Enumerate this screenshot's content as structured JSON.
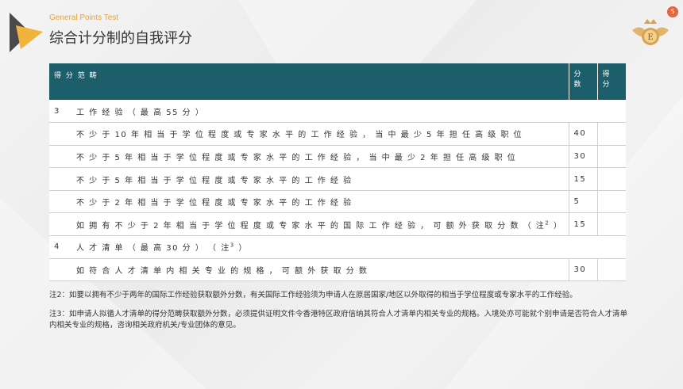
{
  "header": {
    "subtitle": "General Points Test",
    "title": "综合计分制的自我评分",
    "corner_icon": "s-badge-icon",
    "corner_text": "S"
  },
  "colors": {
    "header_bg": "#1d5e6b",
    "accent": "#e8a33a",
    "text": "#333333"
  },
  "table": {
    "headers": {
      "range": "得 分 范 畴",
      "score": "分 数",
      "got": "得 分"
    },
    "rows": [
      {
        "idx": "3",
        "text": "工 作 经 验 （ 最 高 55 分 ）",
        "score": "",
        "section": true
      },
      {
        "idx": "",
        "text": "不 少 于 10 年 相 当 于 学 位 程 度 或 专 家 水 平 的 工 作 经 验 ， 当 中 最 少 5 年 担 任 高 级 职 位",
        "score": "40"
      },
      {
        "idx": "",
        "text": "不 少 于 5 年 相 当 于 学 位 程 度 或 专 家 水 平 的 工 作 经 验 ， 当 中 最 少 2 年 担 任 高 级 职 位",
        "score": "30"
      },
      {
        "idx": "",
        "text": "不 少 于 5 年 相 当 于 学 位 程 度 或 专 家 水 平 的 工 作 经 验",
        "score": "15"
      },
      {
        "idx": "",
        "text": "不 少 于 2 年 相 当 于 学 位 程 度 或 专 家 水 平 的 工 作 经 验",
        "score": "5"
      },
      {
        "idx": "",
        "text": "如 拥 有 不 少 于 2 年 相 当 于 学 位 程 度 或 专 家 水 平 的 国 际 工 作 经 验 ， 可 额 外 获 取 分 数 （ 注",
        "sup": "2",
        "tail": " ）",
        "score": "15"
      },
      {
        "idx": "4",
        "text": "人 才 清 单 （ 最 高 30 分 ） （ 注",
        "sup": "3",
        "tail": " ）",
        "score": "",
        "section": true
      },
      {
        "idx": "",
        "text": "如 符 合 人 才 清 单 内 相 关 专 业 的 规 格 ， 可 额 外 获 取 分 数",
        "score": "30"
      }
    ]
  },
  "notes": [
    "注2：如要以拥有不少于两年的国际工作经验获取额外分数，有关国际工作经验须为申请人在原居国家/地区以外取得的相当于学位程度或专家水平的工作经验。",
    "注3：如申请人拟循人才清单的得分范畴获取额外分数，必须提供证明文件令香港特区政府信纳其符合人才清单内相关专业的规格。入境处亦可能就个别申请是否符合人才清单内相关专业的规格，咨询相关政府机关/专业团体的意见。"
  ]
}
